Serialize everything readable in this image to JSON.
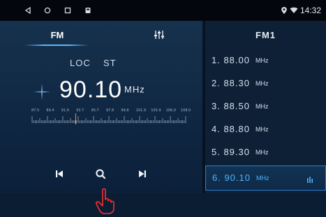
{
  "status_bar": {
    "icons": [
      "back-icon",
      "home-icon",
      "recent-apps-icon",
      "app-icon",
      "location-icon",
      "wifi-icon"
    ],
    "time": "14:32"
  },
  "radio": {
    "band_tab": "FM",
    "loc_label": "LOC",
    "st_label": "ST",
    "frequency": "90.10",
    "unit": "MHz",
    "scale_labels": [
      "87.5",
      "89.4",
      "91.6",
      "93.7",
      "95.7",
      "97.8",
      "99.8",
      "101.9",
      "103.9",
      "106.0",
      "108.0"
    ],
    "controls": [
      "previous-icon",
      "search-icon",
      "next-icon"
    ]
  },
  "preset_list": {
    "title": "FM1",
    "unit": "MHz",
    "presets": [
      {
        "label": "1. 88.00"
      },
      {
        "label": "2. 88.30"
      },
      {
        "label": "3. 88.50"
      },
      {
        "label": "4. 88.80"
      },
      {
        "label": "5. 89.30"
      },
      {
        "label": "6. 90.10"
      }
    ],
    "active_index": 5
  },
  "colors": {
    "accent": "#4fb2ff",
    "background": "#0b1d33",
    "needle": "#ff8a3d"
  }
}
